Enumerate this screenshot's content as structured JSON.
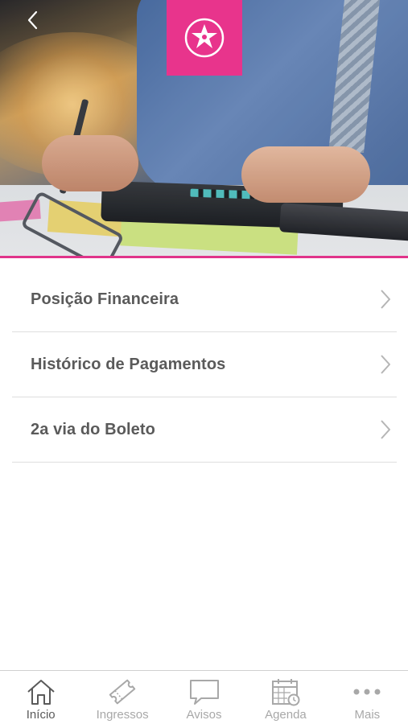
{
  "colors": {
    "accent": "#e8348c",
    "text": "#5a5a5a",
    "muted": "#a8a8a8",
    "divider": "#dedede"
  },
  "header": {
    "back_icon": "chevron-left-icon",
    "logo_icon": "star-logo-icon"
  },
  "menu": {
    "items": [
      {
        "label": "Posição Financeira"
      },
      {
        "label": "Histórico de Pagamentos"
      },
      {
        "label": "2a via do Boleto"
      }
    ]
  },
  "tabbar": {
    "tabs": [
      {
        "label": "Início",
        "icon": "home-icon",
        "active": true
      },
      {
        "label": "Ingressos",
        "icon": "ticket-icon",
        "active": false
      },
      {
        "label": "Avisos",
        "icon": "chat-bubble-icon",
        "active": false
      },
      {
        "label": "Agenda",
        "icon": "calendar-icon",
        "active": false
      },
      {
        "label": "Mais",
        "icon": "more-dots-icon",
        "active": false
      }
    ]
  }
}
